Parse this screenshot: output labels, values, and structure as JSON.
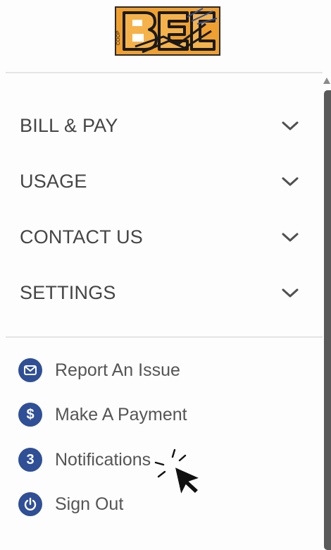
{
  "logo": {
    "text": "BEC",
    "colors": {
      "orange": "#f0a030",
      "dark": "#1a1a1a"
    }
  },
  "menu": {
    "items": [
      {
        "label": "BILL & PAY",
        "icon": "chevron-down-icon"
      },
      {
        "label": "USAGE",
        "icon": "chevron-down-icon"
      },
      {
        "label": "CONTACT US",
        "icon": "chevron-down-icon"
      },
      {
        "label": "SETTINGS",
        "icon": "chevron-down-icon"
      }
    ]
  },
  "links": {
    "items": [
      {
        "label": "Report An Issue",
        "icon": "mail-icon"
      },
      {
        "label": "Make A Payment",
        "icon": "dollar-icon",
        "glyph": "$"
      },
      {
        "label": "Notifications",
        "icon": "notification-count-badge",
        "glyph": "3"
      },
      {
        "label": "Sign Out",
        "icon": "power-icon"
      }
    ]
  },
  "colors": {
    "accent": "#2f4f96",
    "menu_text": "#454545",
    "link_text": "#555555",
    "scrollbar": "#5a5a5a"
  }
}
